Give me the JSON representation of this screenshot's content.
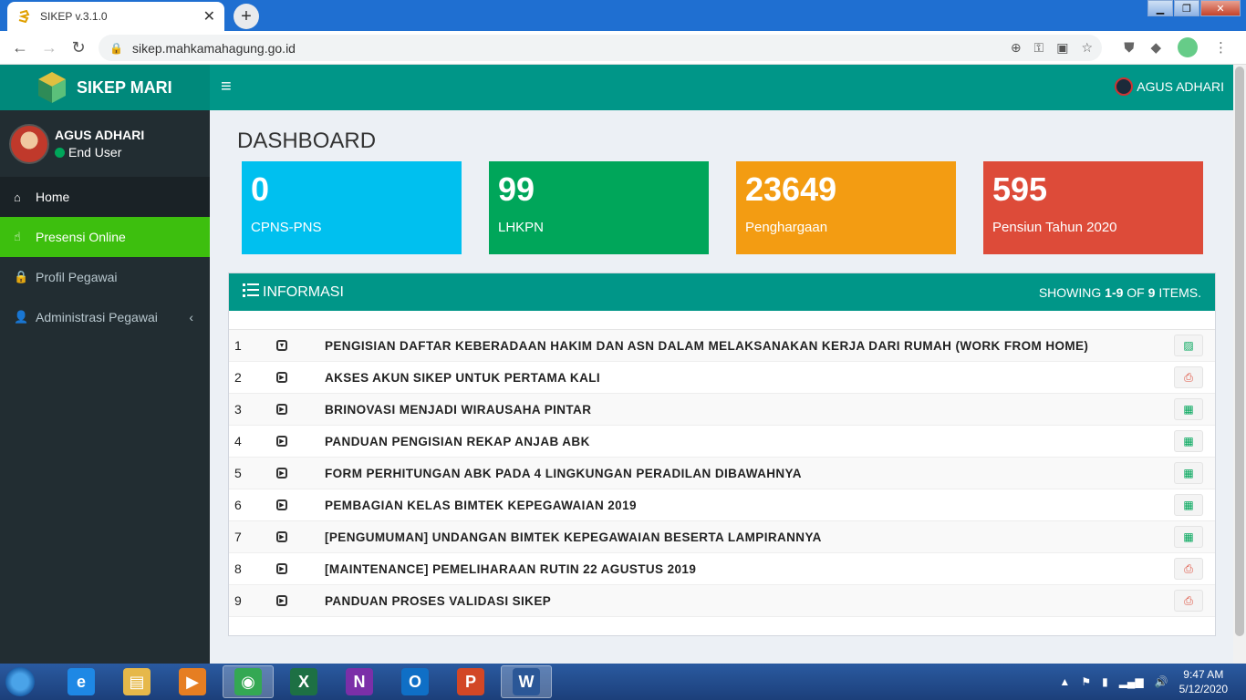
{
  "browser": {
    "tab_title": "SIKEP v.3.1.0",
    "tab_close": "✕",
    "new_tab": "+",
    "url": "sikep.mahkamahagung.go.id",
    "window_controls": {
      "minimize": "▁",
      "maximize": "❐",
      "close": "✕"
    }
  },
  "header": {
    "app_name": "SIKEP MARI",
    "menu_toggle": "≡",
    "user_name": "AGUS ADHARI"
  },
  "sidebar": {
    "user_name": "AGUS ADHARI",
    "user_role": "End User",
    "items": [
      {
        "label": "Home",
        "icon": "home-icon",
        "glyph": "⌂"
      },
      {
        "label": "Presensi Online",
        "icon": "hand-pointer-icon",
        "glyph": "☝"
      },
      {
        "label": "Profil Pegawai",
        "icon": "user-lock-icon",
        "glyph": "🔒"
      },
      {
        "label": "Administrasi Pegawai",
        "icon": "user-icon",
        "glyph": "👤",
        "chevron": "‹"
      }
    ]
  },
  "main": {
    "page_title": "DASHBOARD",
    "boxes": [
      {
        "value": "0",
        "label": "CPNS-PNS",
        "color": "#00c0ef"
      },
      {
        "value": "99",
        "label": "LHKPN",
        "color": "#00a65a"
      },
      {
        "value": "23649",
        "label": "Penghargaan",
        "color": "#f39c12"
      },
      {
        "value": "595",
        "label": "Pensiun Tahun 2020",
        "color": "#dd4b39"
      }
    ],
    "info": {
      "title": "INFORMASI",
      "showing_prefix": "SHOWING ",
      "showing_range": "1-9",
      "showing_of": " OF ",
      "showing_total": "9",
      "showing_suffix": " ITEMS.",
      "rows": [
        {
          "no": "1",
          "title": "PENGISIAN DAFTAR KEBERADAAN HAKIM DAN ASN DALAM MELAKSANAKAN KERJA DARI RUMAH (WORK FROM HOME)",
          "file": "image"
        },
        {
          "no": "2",
          "title": "AKSES AKUN SIKEP UNTUK PERTAMA KALI",
          "file": "pdf"
        },
        {
          "no": "3",
          "title": "BRINOVASI MENJADI WIRAUSAHA PINTAR",
          "file": "excel"
        },
        {
          "no": "4",
          "title": "PANDUAN PENGISIAN REKAP ANJAB ABK",
          "file": "excel"
        },
        {
          "no": "5",
          "title": "FORM PERHITUNGAN ABK PADA 4 LINGKUNGAN PERADILAN DIBAWAHNYA",
          "file": "excel"
        },
        {
          "no": "6",
          "title": "PEMBAGIAN KELAS BIMTEK KEPEGAWAIAN 2019",
          "file": "excel"
        },
        {
          "no": "7",
          "title": "[PENGUMUMAN] UNDANGAN BIMTEK KEPEGAWAIAN BESERTA LAMPIRANNYA",
          "file": "excel"
        },
        {
          "no": "8",
          "title": "[MAINTENANCE] PEMELIHARAAN RUTIN 22 AGUSTUS 2019",
          "file": "pdf"
        },
        {
          "no": "9",
          "title": "PANDUAN PROSES VALIDASI SIKEP",
          "file": "pdf"
        }
      ]
    }
  },
  "taskbar": {
    "apps": [
      {
        "name": "internet-explorer",
        "glyph": "e",
        "color": "#1e88e5"
      },
      {
        "name": "file-explorer",
        "glyph": "▤",
        "color": "#e6b84a"
      },
      {
        "name": "media-player",
        "glyph": "▶",
        "color": "#e67e22"
      },
      {
        "name": "chrome",
        "glyph": "◉",
        "color": "#34a853",
        "selected": true
      },
      {
        "name": "excel",
        "glyph": "X",
        "color": "#1d7044"
      },
      {
        "name": "onenote",
        "glyph": "N",
        "color": "#7b2fa8"
      },
      {
        "name": "outlook",
        "glyph": "O",
        "color": "#0f6fc6"
      },
      {
        "name": "powerpoint",
        "glyph": "P",
        "color": "#d24726"
      },
      {
        "name": "word",
        "glyph": "W",
        "color": "#2b5797",
        "selected": true
      }
    ],
    "time": "9:47 AM",
    "date": "5/12/2020"
  }
}
